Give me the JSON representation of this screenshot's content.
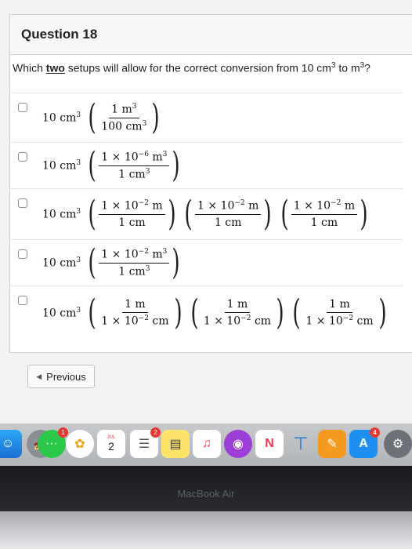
{
  "question": {
    "title": "Question 18",
    "prompt_before": "Which ",
    "prompt_emphasis": "two",
    "prompt_after": " setups will allow for the correct conversion from 10 cm",
    "prompt_exp": "3",
    "prompt_to": " to m",
    "prompt_exp2": "3",
    "prompt_end": "?"
  },
  "options": [
    {
      "qty": "10 cm",
      "qty_exp": "3",
      "factors": [
        {
          "num": "1 m",
          "num_exp": "3",
          "den": "100 cm",
          "den_exp": "3"
        }
      ]
    },
    {
      "qty": "10 cm",
      "qty_exp": "3",
      "factors": [
        {
          "num": "1 × 10",
          "num_exp": "−6",
          "num_tail": " m",
          "num_tail_exp": "3",
          "den": "1 cm",
          "den_exp": "3"
        }
      ]
    },
    {
      "qty": "10 cm",
      "qty_exp": "3",
      "factors": [
        {
          "num": "1 × 10",
          "num_exp": "−2",
          "num_tail": " m",
          "den": "1 cm"
        },
        {
          "num": "1 × 10",
          "num_exp": "−2",
          "num_tail": " m",
          "den": "1 cm"
        },
        {
          "num": "1 × 10",
          "num_exp": "−2",
          "num_tail": " m",
          "den": "1 cm"
        }
      ]
    },
    {
      "qty": "10 cm",
      "qty_exp": "3",
      "factors": [
        {
          "num": "1 × 10",
          "num_exp": "−2",
          "num_tail": " m",
          "num_tail_exp": "3",
          "den": "1 cm",
          "den_exp": "3"
        }
      ]
    },
    {
      "qty": "10 cm",
      "qty_exp": "3",
      "factors": [
        {
          "num": "1 m",
          "den": "1 × 10",
          "den_exp": "−2",
          "den_tail": " cm"
        },
        {
          "num": "1 m",
          "den": "1 × 10",
          "den_exp": "−2",
          "den_tail": " cm"
        },
        {
          "num": "1 m",
          "den": "1 × 10",
          "den_exp": "−2",
          "den_tail": " cm"
        }
      ]
    }
  ],
  "nav": {
    "previous_label": "Previous"
  },
  "dock": {
    "badge_1": "1",
    "calendar_month": "JUL",
    "calendar_day": "2",
    "badge_2": "2",
    "badge_4": "4",
    "icons": [
      "finder-icon",
      "launchpad-icon",
      "messages-icon",
      "photos-icon",
      "calendar-icon",
      "reminders-icon",
      "notes-icon",
      "music-icon",
      "podcasts-icon",
      "news-icon",
      "keynote-icon",
      "pages-icon",
      "app-store-icon",
      "system-preferences-icon"
    ]
  },
  "device": {
    "label": "MacBook Air"
  }
}
